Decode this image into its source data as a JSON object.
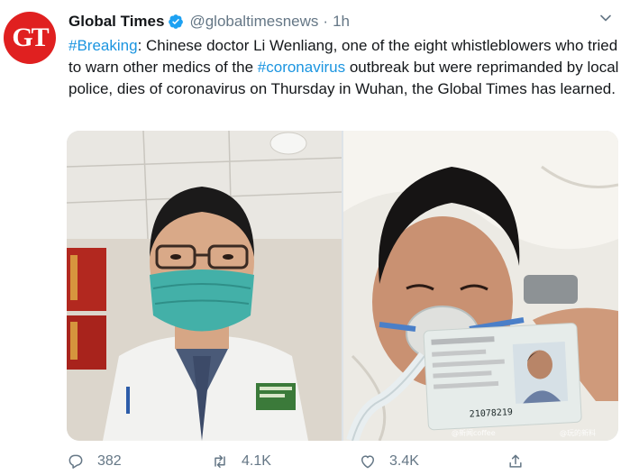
{
  "tweet": {
    "avatar_initials": "GT",
    "display_name": "Global Times",
    "handle": "@globaltimesnews",
    "separator": "·",
    "time": "1h",
    "text_parts": {
      "hashtag1": "#Breaking",
      "text1": ": Chinese doctor Li Wenliang, one of the eight whistleblowers who tried to warn other medics of the ",
      "hashtag2": "#coronavirus",
      "text2": " outbreak but were reprimanded by local police, dies of coronavirus on Thursday in Wuhan, the Global Times has learned."
    },
    "photo_right": {
      "card_number": "21078219",
      "watermark_left": "@新闻coffee",
      "watermark_right": "@玩的新料"
    }
  },
  "actions": {
    "reply_count": "382",
    "retweet_count": "4.1K",
    "like_count": "3.4K"
  },
  "colors": {
    "link": "#1b95e0",
    "muted": "#657786",
    "brand_red": "#e02020",
    "verified": "#1da1f2"
  }
}
